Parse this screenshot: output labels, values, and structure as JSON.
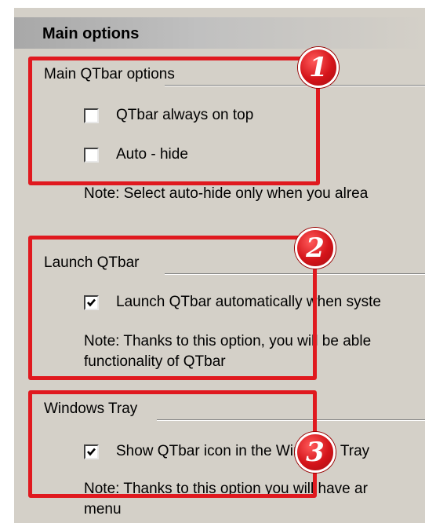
{
  "header": {
    "title": "Main options"
  },
  "section1": {
    "title": "Main QTbar options",
    "opt_on_top": {
      "label": "QTbar always on top",
      "checked": false
    },
    "opt_autohide": {
      "label": "Auto - hide",
      "checked": false
    },
    "note": "Note: Select auto-hide only when you alrea",
    "badge": "1"
  },
  "section2": {
    "title": "Launch QTbar",
    "opt_launch": {
      "label": "Launch QTbar automatically when syste",
      "checked": true
    },
    "note_line1": "Note: Thanks to this option, you will be able",
    "note_line2": "functionality of QTbar",
    "badge": "2"
  },
  "section3": {
    "title": "Windows Tray",
    "opt_tray": {
      "label": "Show QTbar icon in the Windows Tray",
      "checked": true
    },
    "note_line1": "Note: Thanks to this option you will have ar",
    "note_line2": "menu",
    "badge": "3"
  },
  "colors": {
    "highlight": "#e0191f",
    "panel": "#d4d0c8",
    "badge": "#d4141a"
  }
}
